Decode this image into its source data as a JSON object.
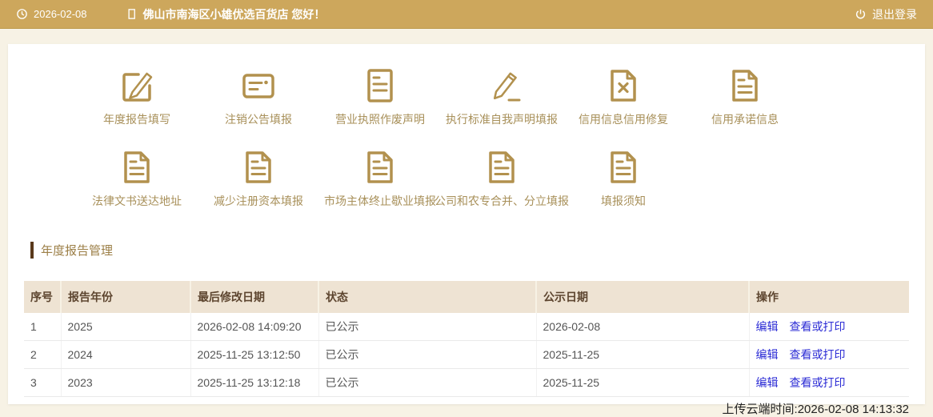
{
  "topbar": {
    "date": "2026-02-08",
    "company": "佛山市南海区小雄优选百货店 您好！",
    "logout_label": "退出登录"
  },
  "grid": {
    "row1": [
      {
        "label": "年度报告填写",
        "icon": "edit-square-icon"
      },
      {
        "label": "注销公告填报",
        "icon": "announcement-card-icon"
      },
      {
        "label": "营业执照作废声明",
        "icon": "document-lines-icon"
      },
      {
        "label": "执行标准自我声明填报",
        "icon": "pencil-icon"
      },
      {
        "label": "信用信息信用修复",
        "icon": "document-x-icon"
      },
      {
        "label": "信用承诺信息",
        "icon": "document-fold-icon"
      }
    ],
    "row2": [
      {
        "label": "法律文书送达地址",
        "icon": "document-fold-icon"
      },
      {
        "label": "减少注册资本填报",
        "icon": "document-fold-icon"
      },
      {
        "label": "市场主体终止歇业填报",
        "icon": "document-fold-icon"
      },
      {
        "label": "公司和农专合并、分立填报",
        "icon": "document-fold-icon"
      },
      {
        "label": "填报须知",
        "icon": "document-fold-icon"
      }
    ]
  },
  "section": {
    "title": "年度报告管理"
  },
  "table": {
    "headers": [
      "序号",
      "报告年份",
      "最后修改日期",
      "状态",
      "公示日期",
      "操作"
    ],
    "rows": [
      {
        "no": "1",
        "year": "2025",
        "modified": "2026-02-08 14:09:20",
        "status": "已公示",
        "published": "2026-02-08",
        "actions": [
          "编辑",
          "查看或打印"
        ]
      },
      {
        "no": "2",
        "year": "2024",
        "modified": "2025-11-25 13:12:50",
        "status": "已公示",
        "published": "2025-11-25",
        "actions": [
          "编辑",
          "查看或打印"
        ]
      },
      {
        "no": "3",
        "year": "2023",
        "modified": "2025-11-25 13:12:18",
        "status": "已公示",
        "published": "2025-11-25",
        "actions": [
          "编辑",
          "查看或打印"
        ]
      }
    ]
  },
  "footer": {
    "upload_time": "上传云端时间:2026-02-08 14:13:32"
  },
  "colors": {
    "topbar_bg": "#cda75c",
    "icon_gold": "#b2914e",
    "label_gold": "#a8905a",
    "header_bg": "#eee3d3",
    "header_text": "#5d452f",
    "accent_bar": "#59391b",
    "link_blue": "#2b2bd5",
    "page_bg": "#f7f2e5"
  }
}
